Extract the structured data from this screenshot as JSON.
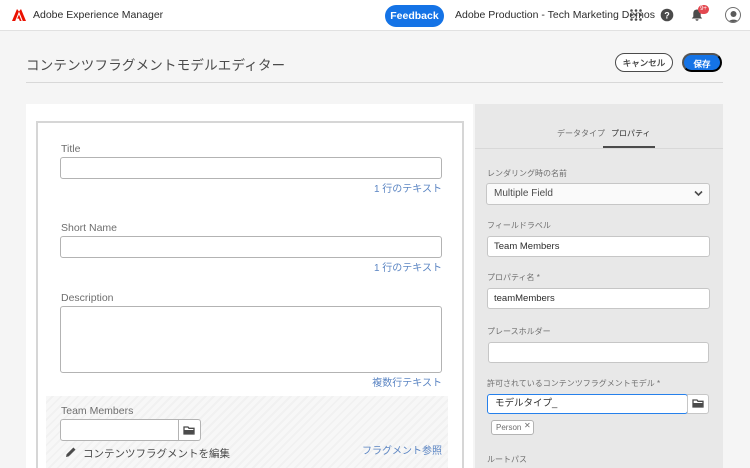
{
  "topbar": {
    "app_title": "Adobe Experience Manager",
    "feedback_label": "Feedback",
    "org_name": "Adobe Production - Tech Marketing Demos",
    "notification_count": "9+"
  },
  "header": {
    "page_title": "コンテンツフラグメントモデルエディター",
    "cancel_label": "キャンセル",
    "save_label": "保存"
  },
  "form": {
    "fields": [
      {
        "label": "Title",
        "type": "1 行のテキスト"
      },
      {
        "label": "Short Name",
        "type": "1 行のテキスト"
      },
      {
        "label": "Description",
        "type": "複数行テキスト"
      },
      {
        "label": "Team Members",
        "type": "フラグメント参照",
        "edit_link": "コンテンツフラグメントを編集"
      }
    ]
  },
  "rail": {
    "tabs": [
      "データタイプ",
      "プロパティ"
    ],
    "active_tab": "プロパティ",
    "render_as_label": "レンダリング時の名前",
    "render_as_value": "Multiple Field",
    "field_label_label": "フィールドラベル",
    "field_label_value": "Team Members",
    "property_name_label": "プロパティ名 *",
    "property_name_value": "teamMembers",
    "placeholder_label": "プレースホルダー",
    "placeholder_value": "",
    "allowed_models_label": "許可されているコンテンツフラグメントモデル *",
    "allowed_models_value": "モデルタイプ_",
    "allowed_model_tag": "Person",
    "root_path_label": "ルートパス"
  },
  "colors": {
    "accent": "#1473e6",
    "badge": "#e34850",
    "field_type_text": "#5b85c3"
  }
}
